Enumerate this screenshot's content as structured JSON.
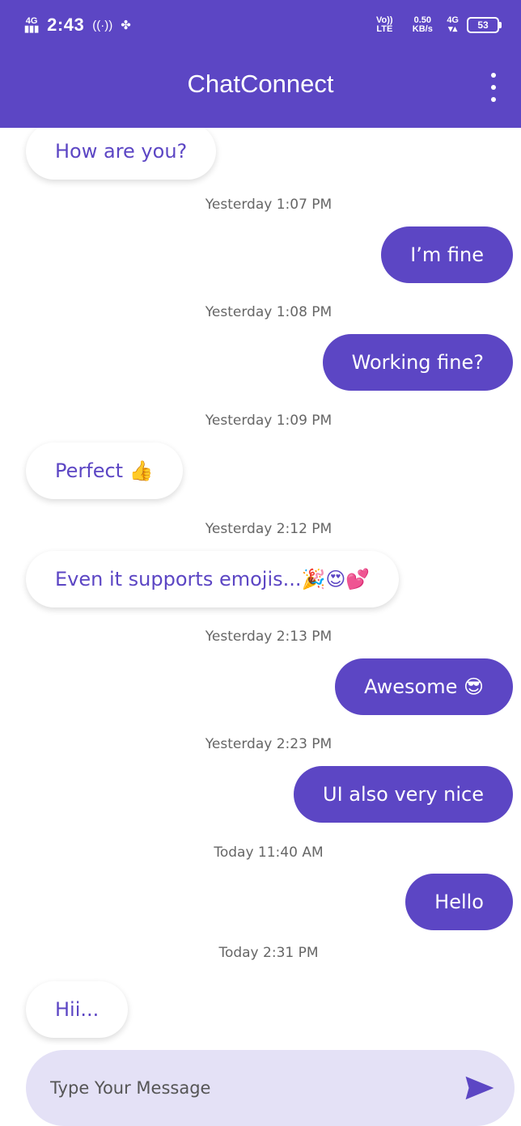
{
  "status_bar": {
    "network": "4G",
    "time": "2:43",
    "volte": "Vo)) LTE",
    "speed": "0.50 KB/s",
    "network_right": "4G",
    "battery": "53"
  },
  "header": {
    "title": "ChatConnect",
    "menu_icon": "more-vertical-icon"
  },
  "messages": [
    {
      "side": "in",
      "text": "How are you?"
    },
    {
      "timestamp": "Yesterday 1:07 PM",
      "side": "out",
      "text": "I’m fine"
    },
    {
      "timestamp": "Yesterday 1:08 PM",
      "side": "out",
      "text": "Working fine?"
    },
    {
      "timestamp": "Yesterday 1:09 PM",
      "side": "in",
      "text": "Perfect 👍"
    },
    {
      "timestamp": "Yesterday 2:12 PM",
      "side": "in",
      "text": "Even it supports emojis...🎉😍💕"
    },
    {
      "timestamp": "Yesterday 2:13 PM",
      "side": "out",
      "text": "Awesome 😎"
    },
    {
      "timestamp": "Yesterday 2:23 PM",
      "side": "out",
      "text": "UI also very nice"
    },
    {
      "timestamp": "Today 11:40 AM",
      "side": "out",
      "text": "Hello"
    },
    {
      "timestamp": "Today 2:31 PM",
      "side": "in",
      "text": "Hii..."
    }
  ],
  "composer": {
    "placeholder": "Type Your Message",
    "send_icon": "send-icon"
  },
  "colors": {
    "primary": "#5c46c4",
    "composer_bg": "#e4e1f6"
  }
}
